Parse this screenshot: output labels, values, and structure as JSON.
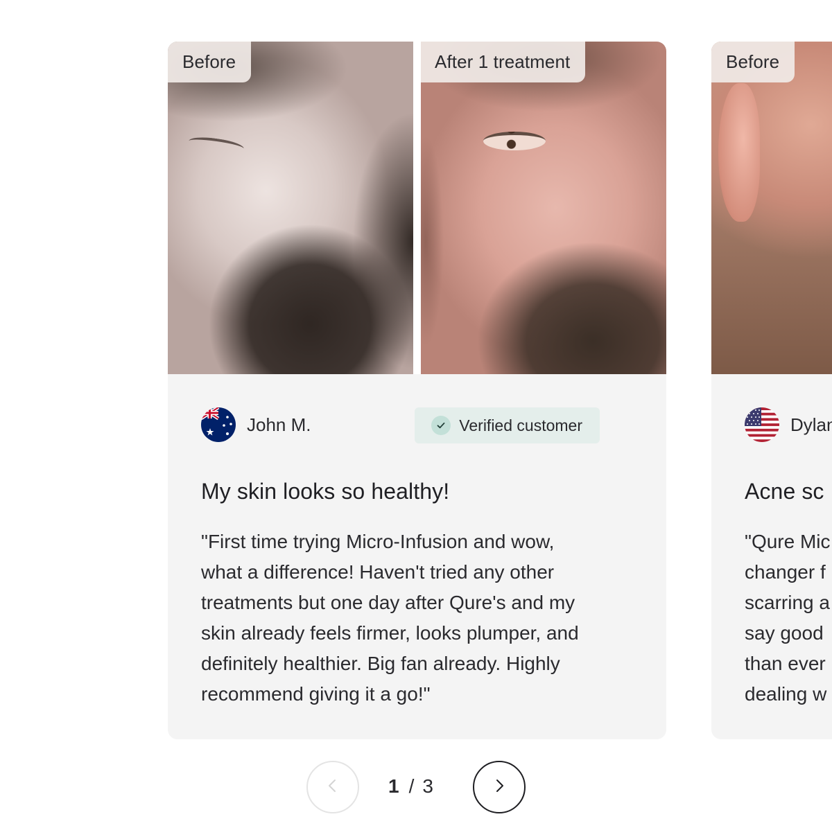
{
  "carousel": {
    "cards": [
      {
        "before_label": "Before",
        "after_label": "After 1 treatment",
        "reviewer_name": "John M.",
        "flag_icon": "australia-flag-icon",
        "verified_label": "Verified customer",
        "title": "My skin looks so healthy!",
        "text": "\"First time trying Micro-Infusion and wow,\nwhat a difference! Haven't tried any other\ntreatments but one day after Qure's and my\nskin already feels firmer, looks plumper, and\ndefinitely healthier. Big fan already. Highly\nrecommend giving it a go!\""
      },
      {
        "before_label": "Before",
        "reviewer_name": "Dylan",
        "flag_icon": "usa-flag-icon",
        "title": "Acne sc",
        "text": "\"Qure Mic\nchanger f\nscarring a\nsay good\nthan ever\ndealing w"
      }
    ]
  },
  "pager": {
    "current": "1",
    "separator": "/",
    "total": "3",
    "prev_icon": "chevron-left-icon",
    "next_icon": "chevron-right-icon"
  },
  "colors": {
    "card_bg": "#f4f4f4",
    "verified_bg": "#e4eeeb",
    "check_bg": "#c3e0d8",
    "text": "#2a2a2e"
  }
}
